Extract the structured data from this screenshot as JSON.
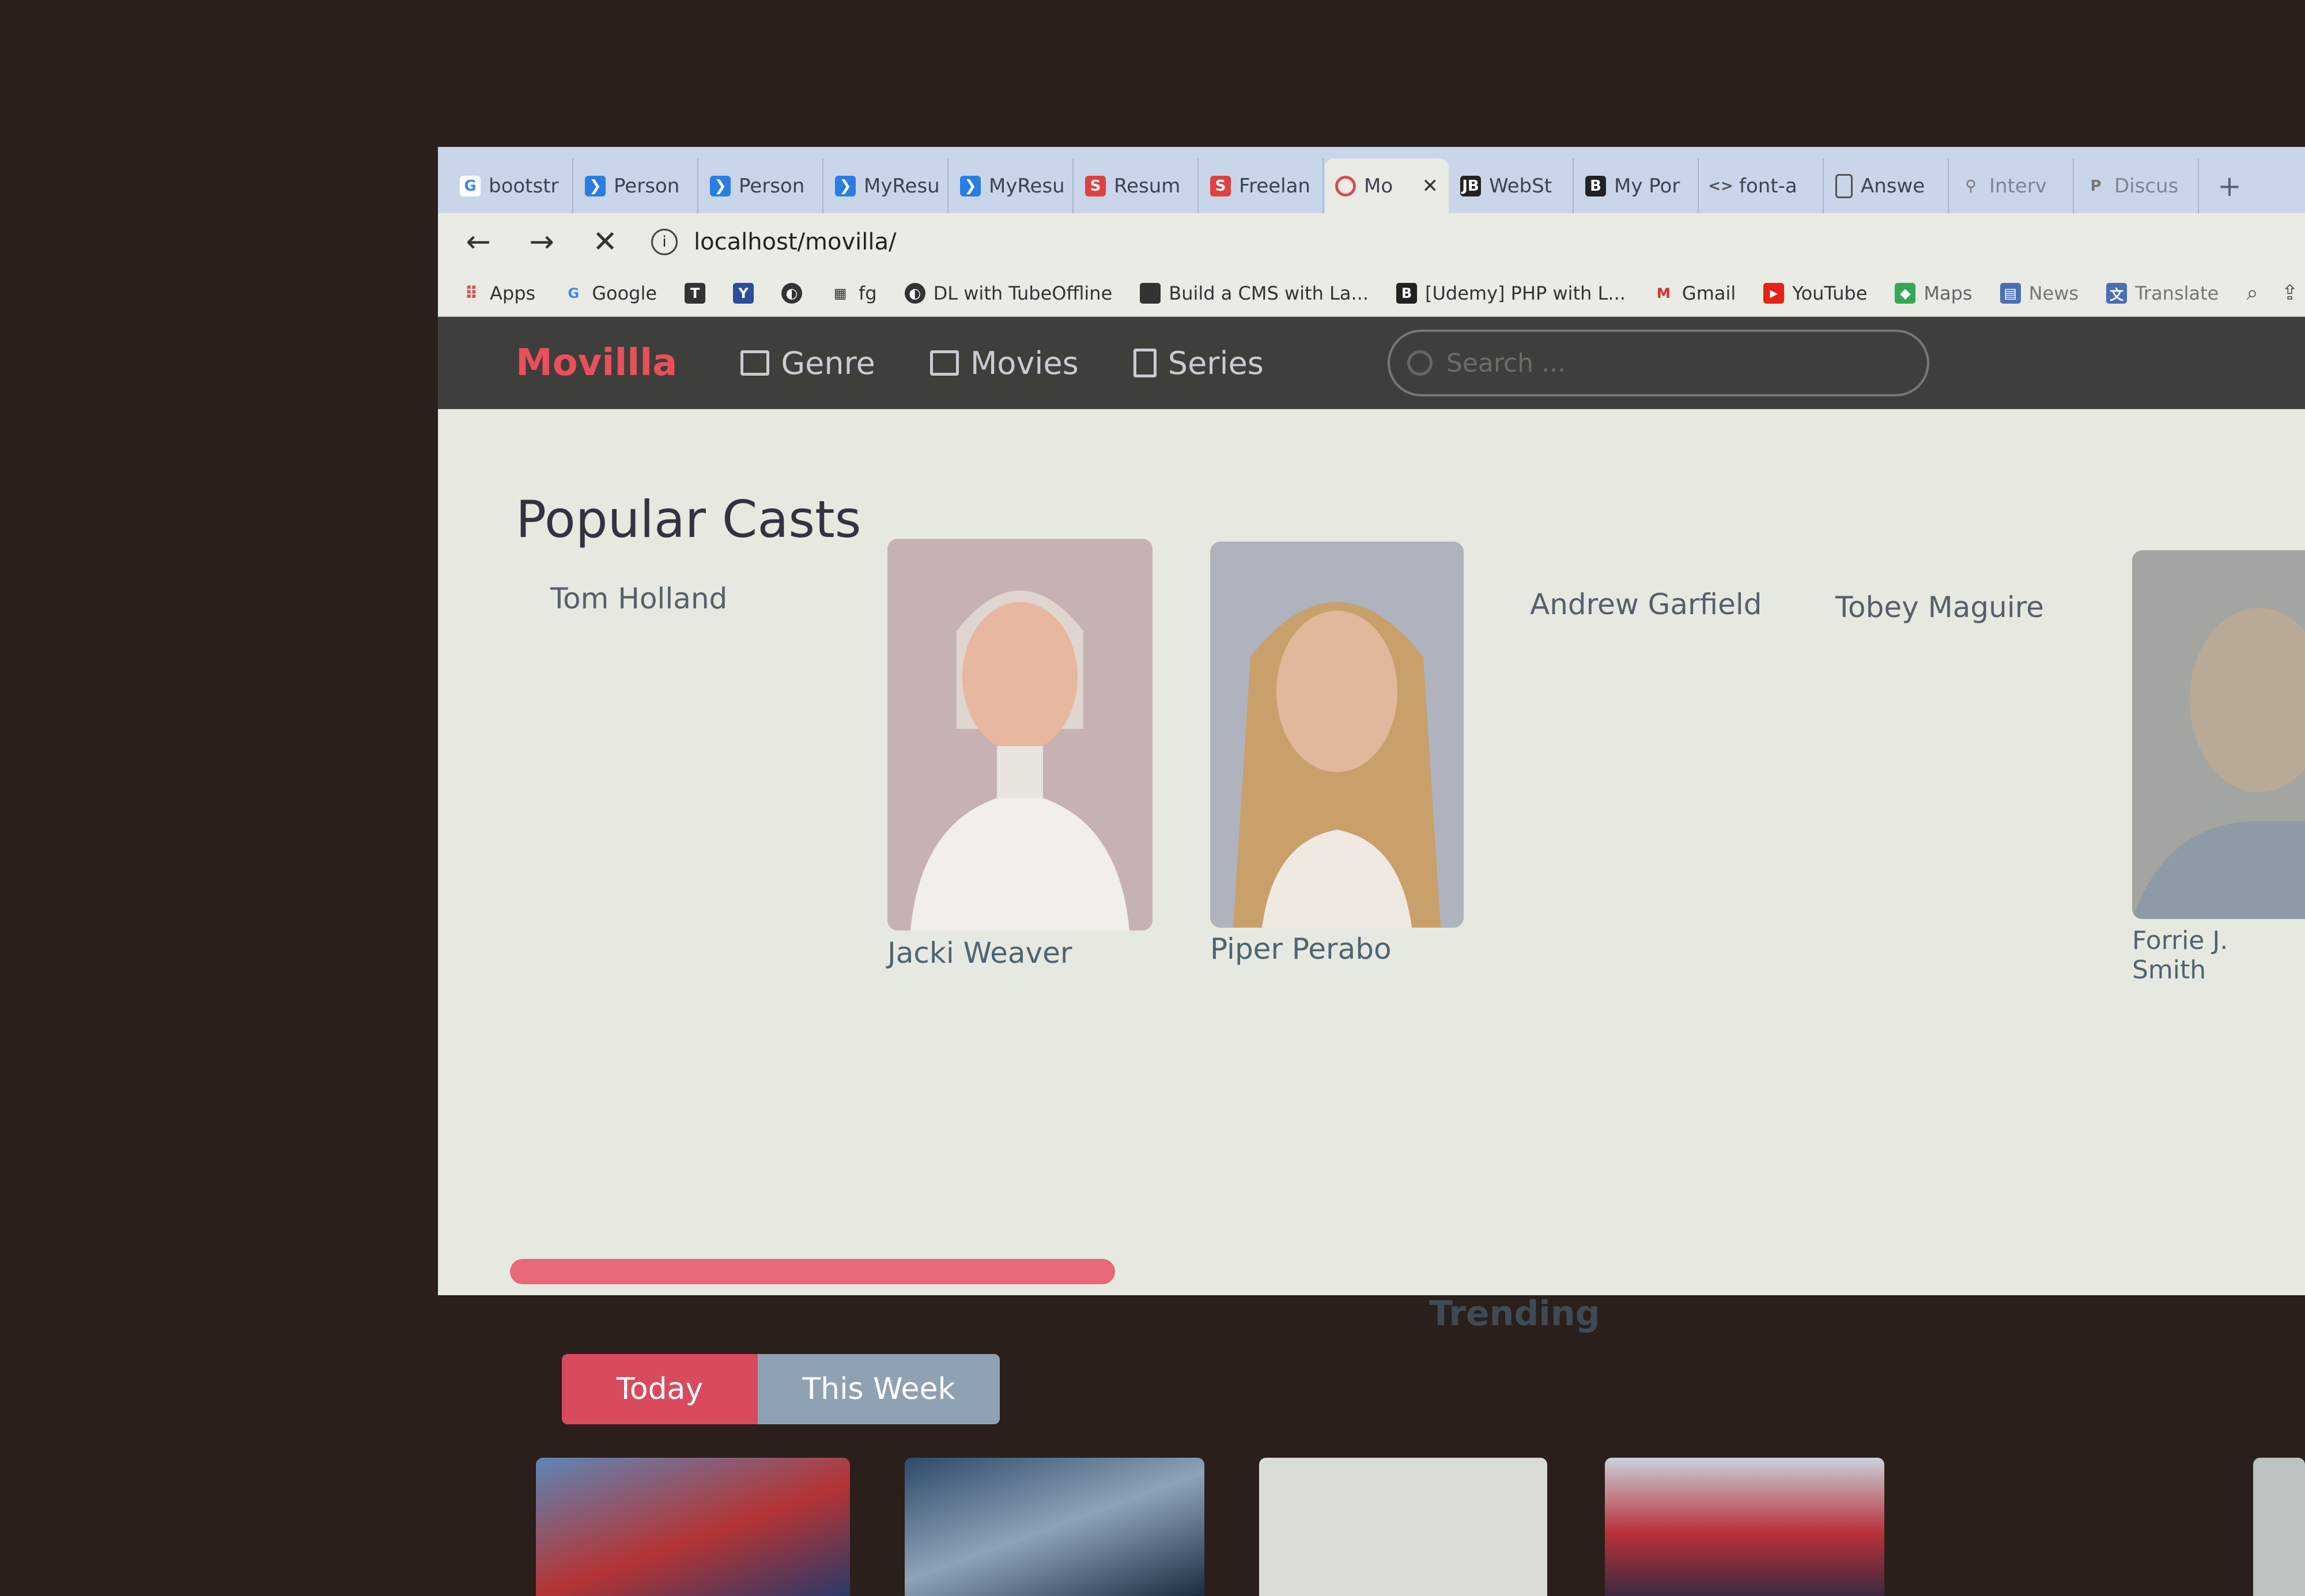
{
  "tabs": [
    {
      "label": "bootstr",
      "icon": "google-icon",
      "color": "#4285f4",
      "active": false
    },
    {
      "label": "Person",
      "icon": "brand-icon",
      "color": "#2a7de1",
      "active": false
    },
    {
      "label": "Person",
      "icon": "brand-icon",
      "color": "#2a7de1",
      "active": false
    },
    {
      "label": "MyResu",
      "icon": "brand-icon",
      "color": "#2a7de1",
      "active": false
    },
    {
      "label": "MyResu",
      "icon": "brand-icon",
      "color": "#2a7de1",
      "active": false
    },
    {
      "label": "Resum",
      "icon": "s-icon",
      "color": "#e0403f",
      "active": false
    },
    {
      "label": "Freelan",
      "icon": "s-icon",
      "color": "#e0403f",
      "active": false
    },
    {
      "label": "Mo",
      "icon": "loading-icon",
      "color": "#d94a5c",
      "active": true
    },
    {
      "label": "WebSt",
      "icon": "jb-icon",
      "color": "#222222",
      "active": false
    },
    {
      "label": "My Por",
      "icon": "b-icon",
      "color": "#222222",
      "active": false
    },
    {
      "label": "font-a",
      "icon": "code-icon",
      "color": "#555555",
      "active": false
    },
    {
      "label": "Answe",
      "icon": "doc-icon",
      "color": "#555555",
      "active": false
    },
    {
      "label": "Interv",
      "icon": "pin-icon",
      "color": "#777777",
      "active": false
    },
    {
      "label": "Discus",
      "icon": "p-icon",
      "color": "#777777",
      "active": false
    }
  ],
  "address": {
    "url": "localhost/movilla/"
  },
  "bookmarks": [
    {
      "label": "Apps",
      "icon": "apps-icon",
      "color": "#d9534f"
    },
    {
      "label": "Google",
      "icon": "google-icon",
      "color": "#4285f4"
    },
    {
      "label": "",
      "icon": "t-icon",
      "color": "#333333"
    },
    {
      "label": "",
      "icon": "y-icon",
      "color": "#2a4d9c"
    },
    {
      "label": "",
      "icon": "globe-icon",
      "color": "#333333"
    },
    {
      "label": "fg",
      "icon": "fg-icon",
      "color": "#333333"
    },
    {
      "label": "DL with TubeOffline",
      "icon": "globe-icon",
      "color": "#333333"
    },
    {
      "label": "Build a CMS with La...",
      "icon": "bookmark-icon",
      "color": "#333333"
    },
    {
      "label": "[Udemy] PHP with L...",
      "icon": "b-icon",
      "color": "#222222"
    },
    {
      "label": "Gmail",
      "icon": "gmail-icon",
      "color": "#d93025"
    },
    {
      "label": "YouTube",
      "icon": "youtube-icon",
      "color": "#e62117"
    },
    {
      "label": "Maps",
      "icon": "maps-icon",
      "color": "#34a853"
    },
    {
      "label": "News",
      "icon": "news-icon",
      "color": "#4a6fb5"
    },
    {
      "label": "Translate",
      "icon": "translate-icon",
      "color": "#4a6fb5"
    }
  ],
  "site": {
    "brand": "Movillla",
    "nav": [
      {
        "label": "Genre",
        "icon": "list-icon"
      },
      {
        "label": "Movies",
        "icon": "film-icon"
      },
      {
        "label": "Series",
        "icon": "file-icon"
      }
    ],
    "search_placeholder": "Search ..."
  },
  "popular": {
    "title": "Popular Casts",
    "casts": [
      {
        "name": "Tom Holland",
        "has_photo": false
      },
      {
        "name": "Jacki Weaver",
        "has_photo": true
      },
      {
        "name": "Piper Perabo",
        "has_photo": true
      },
      {
        "name": "Andrew Garfield",
        "has_photo": false
      },
      {
        "name": "Tobey Maguire",
        "has_photo": false
      },
      {
        "name": "Forrie J. Smith",
        "has_photo": true
      }
    ],
    "scroll_fraction": 0.37
  },
  "trending": {
    "title": "Trending",
    "toggle": {
      "today": "Today",
      "week": "This Week",
      "selected": "Today"
    }
  }
}
